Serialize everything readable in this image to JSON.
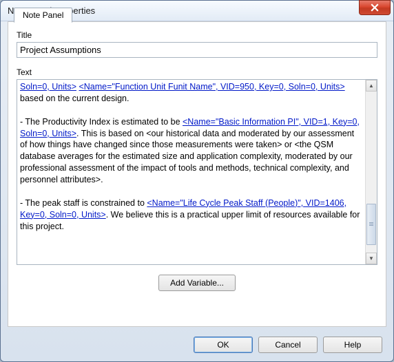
{
  "window": {
    "title": "Note Panel Properties",
    "close_icon": "close-icon"
  },
  "tab": {
    "label": "Note Panel"
  },
  "fields": {
    "title_label": "Title",
    "title_value": "Project Assumptions",
    "text_label": "Text"
  },
  "text_content": {
    "link1": "Soln=0, Units>",
    "spacer1": "  ",
    "link2": "<Name=\"Function Unit Funit Name\", VID=950, Key=0, Soln=0, Units>",
    "tail1": "  based on the current design.",
    "para2_lead": "- The Productivity Index is estimated to be ",
    "link3": "<Name=\"Basic Information PI\", VID=1, Key=0, Soln=0, Units>",
    "tail2": ".  This is based on <our historical data and moderated by our assessment of how things have changed since those measurements were taken> or <the QSM database averages for the estimated size and application complexity, moderated by our professional assessment of the  impact of tools and methods, technical complexity, and personnel attributes>.",
    "para3_lead": "- The peak staff is constrained to ",
    "link4": "<Name=\"Life Cycle Peak Staff (People)\", VID=1406, Key=0, Soln=0, Units>",
    "tail3": ".  We believe this is a practical upper limit of resources available for this project."
  },
  "buttons": {
    "add_variable": "Add Variable...",
    "ok": "OK",
    "cancel": "Cancel",
    "help": "Help"
  }
}
